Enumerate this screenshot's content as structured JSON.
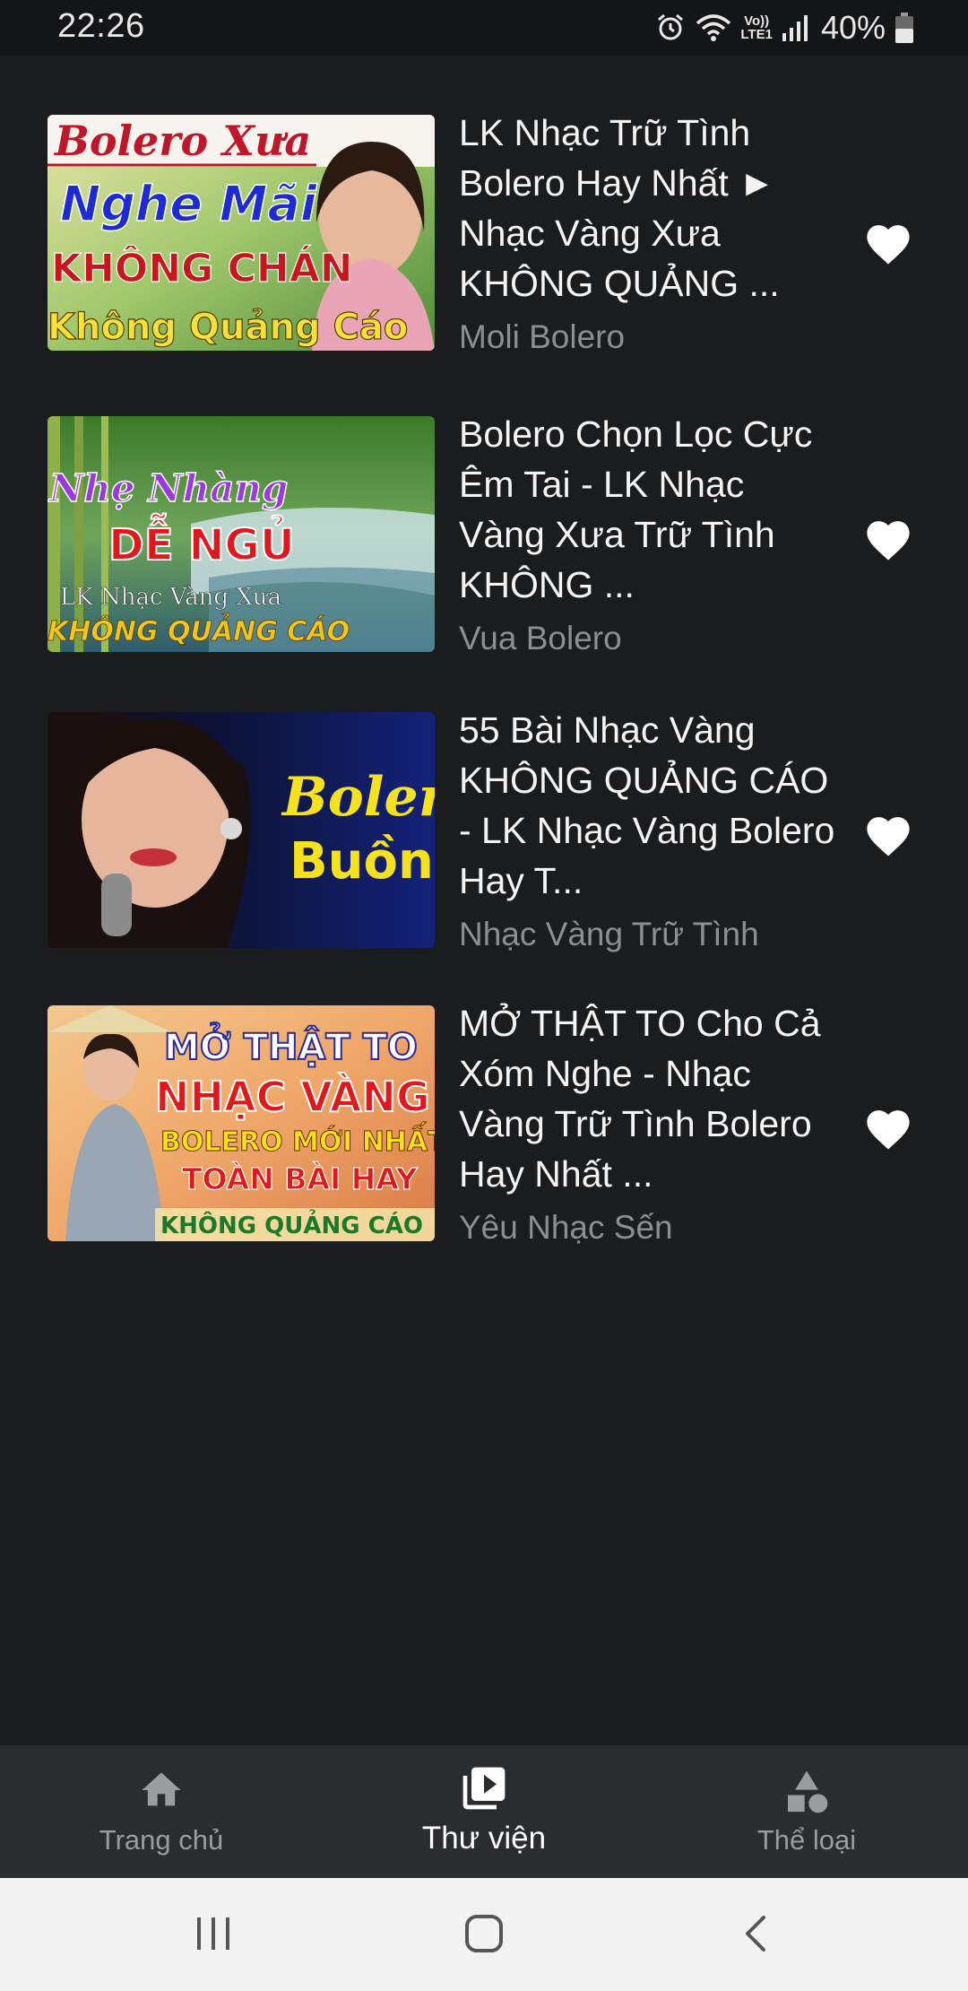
{
  "status_bar": {
    "time": "22:26",
    "volte_top": "Vo))",
    "volte_bottom": "LTE1",
    "battery_percent": "40%"
  },
  "videos": [
    {
      "title": "LK Nhạc Trữ Tình Bolero Hay Nhất ► Nhạc Vàng Xưa KHÔNG QUẢNG ...",
      "channel": "Moli Bolero",
      "thumb_text": [
        "Bolero Xưa",
        "Nghe Mãi",
        "KHÔNG CHÁN",
        "Không Quảng Cáo"
      ]
    },
    {
      "title": "Bolero Chọn Lọc Cực Êm Tai - LK Nhạc Vàng Xưa Trữ Tình KHÔNG ...",
      "channel": "Vua Bolero",
      "thumb_text": [
        "Nhẹ Nhàng",
        "DỄ NGỦ",
        "LK Nhạc Vàng Xưa",
        "KHÔNG QUẢNG CÁO"
      ]
    },
    {
      "title": "55 Bài Nhạc Vàng KHÔNG QUẢNG CÁO - LK Nhạc Vàng Bolero Hay T...",
      "channel": "Nhạc Vàng Trữ Tình",
      "thumb_text": [
        "Bolero",
        "Buồn"
      ]
    },
    {
      "title": "MỞ THẬT TO Cho Cả Xóm Nghe - Nhạc Vàng Trữ Tình Bolero Hay Nhất ...",
      "channel": "Yêu Nhạc Sến",
      "thumb_text": [
        "MỞ THẬT TO",
        "NHẠC VÀNG",
        "BOLERO MỚI NHẤT",
        "TOÀN BÀI HAY",
        "KHÔNG QUẢNG CÁO"
      ]
    }
  ],
  "bottom_nav": {
    "items": [
      {
        "label": "Trang chủ",
        "icon": "home-icon",
        "active": false
      },
      {
        "label": "Thư viện",
        "icon": "library-icon",
        "active": true
      },
      {
        "label": "Thể loại",
        "icon": "category-icon",
        "active": false
      }
    ]
  },
  "system_nav": {
    "recents_icon": "recents-icon",
    "home_icon": "home-button-icon",
    "back_icon": "back-icon"
  },
  "colors": {
    "background": "#1b1c1e",
    "status_bar": "#141517",
    "bottom_nav": "#2b2c2f",
    "system_nav": "#f2f2f2",
    "title_text": "#f4f4f4",
    "channel_text": "#8d8e90",
    "heart": "#ffffff"
  }
}
